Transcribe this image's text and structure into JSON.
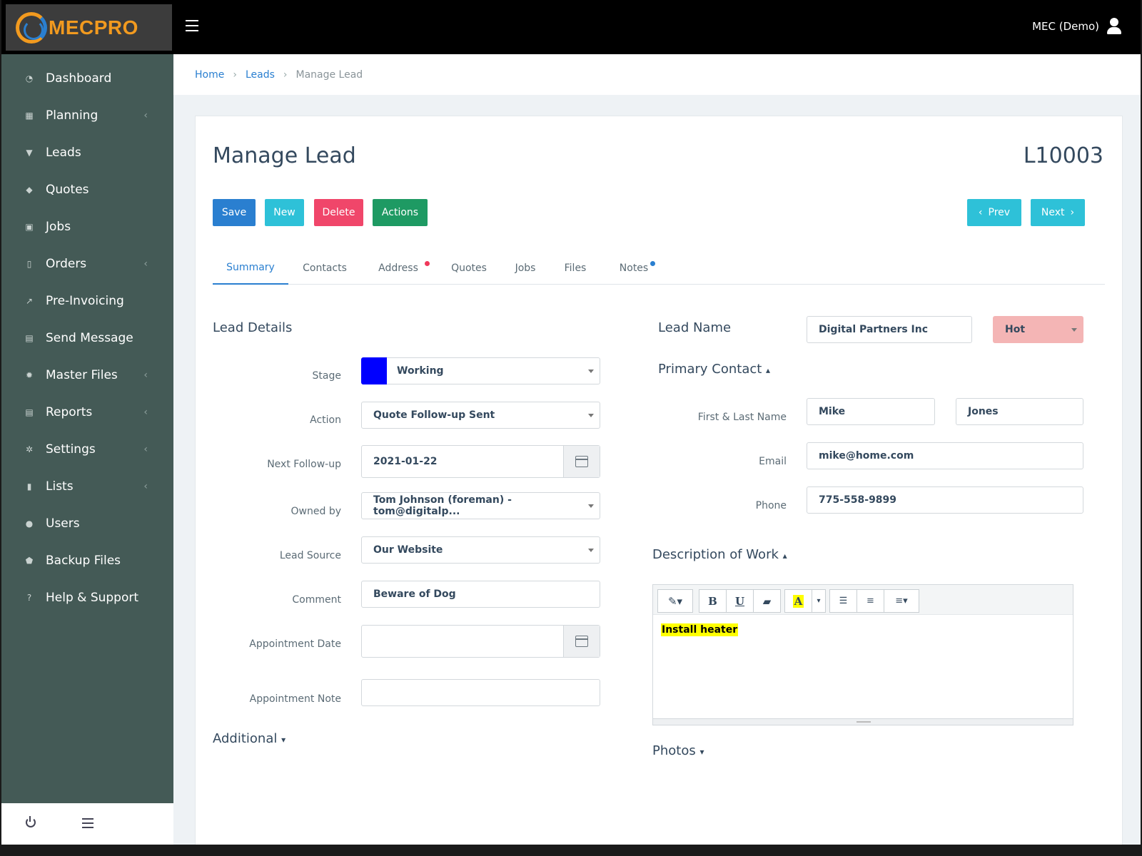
{
  "app": {
    "logo_text": "MECPRO",
    "user_name": "MEC (Demo)"
  },
  "sidebar": {
    "items": [
      {
        "label": "Dashboard",
        "icon": "dashboard-icon",
        "submenu": false
      },
      {
        "label": "Planning",
        "icon": "calendar-icon",
        "submenu": true
      },
      {
        "label": "Leads",
        "icon": "funnel-icon",
        "submenu": false
      },
      {
        "label": "Quotes",
        "icon": "tags-icon",
        "submenu": false
      },
      {
        "label": "Jobs",
        "icon": "jobs-icon",
        "submenu": false
      },
      {
        "label": "Orders",
        "icon": "clipboard-icon",
        "submenu": true
      },
      {
        "label": "Pre-Invoicing",
        "icon": "trend-icon",
        "submenu": false
      },
      {
        "label": "Send Message",
        "icon": "message-icon",
        "submenu": false
      },
      {
        "label": "Master Files",
        "icon": "gear-badge-icon",
        "submenu": true
      },
      {
        "label": "Reports",
        "icon": "file-icon",
        "submenu": true
      },
      {
        "label": "Settings",
        "icon": "gear-icon",
        "submenu": true
      },
      {
        "label": "Lists",
        "icon": "bookmark-icon",
        "submenu": true
      },
      {
        "label": "Users",
        "icon": "user-circle-icon",
        "submenu": false
      },
      {
        "label": "Backup Files",
        "icon": "shield-icon",
        "submenu": false
      },
      {
        "label": "Help & Support",
        "icon": "question-icon",
        "submenu": false
      }
    ]
  },
  "breadcrumb": {
    "home": "Home",
    "leads": "Leads",
    "current": "Manage Lead"
  },
  "page": {
    "title": "Manage Lead",
    "lead_id": "L10003"
  },
  "buttons": {
    "save": "Save",
    "new": "New",
    "delete": "Delete",
    "actions": "Actions",
    "prev": "Prev",
    "next": "Next"
  },
  "tabs": [
    {
      "label": "Summary",
      "active": true,
      "dot": null
    },
    {
      "label": "Contacts",
      "active": false,
      "dot": null
    },
    {
      "label": "Address",
      "active": false,
      "dot": "#f0385a"
    },
    {
      "label": "Quotes",
      "active": false,
      "dot": null
    },
    {
      "label": "Jobs",
      "active": false,
      "dot": null
    },
    {
      "label": "Files",
      "active": false,
      "dot": null
    },
    {
      "label": "Notes",
      "active": false,
      "dot": "#2a7fd0"
    }
  ],
  "lead_details": {
    "heading": "Lead Details",
    "stage_label": "Stage",
    "stage_value": "Working",
    "stage_color": "#0000ff",
    "action_label": "Action",
    "action_value": "Quote Follow-up Sent",
    "followup_label": "Next Follow-up",
    "followup_value": "2021-01-22",
    "owned_label": "Owned by",
    "owned_value": "Tom Johnson (foreman) - tom@digitalp...",
    "source_label": "Lead Source",
    "source_value": "Our Website",
    "comment_label": "Comment",
    "comment_value": "Beware of Dog",
    "appt_date_label": "Appointment Date",
    "appt_date_value": "",
    "appt_note_label": "Appointment Note",
    "appt_note_value": "",
    "additional": "Additional"
  },
  "right": {
    "lead_name_label": "Lead Name",
    "lead_name_value": "Digital Partners Inc",
    "priority_value": "Hot",
    "priority_color": "#f4b5b5",
    "primary_contact": "Primary Contact",
    "name_label": "First & Last Name",
    "first_name": "Mike",
    "last_name": "Jones",
    "email_label": "Email",
    "email_value": "mike@home.com",
    "phone_label": "Phone",
    "phone_value": "775-558-9899",
    "description_heading": "Description of Work",
    "description_text": "Install heater",
    "photos": "Photos"
  },
  "colors": {
    "save": "#2a7fd0",
    "new": "#2ec1d8",
    "delete": "#f0466a",
    "actions": "#1e9a63",
    "nav": "#2ec1d8"
  }
}
